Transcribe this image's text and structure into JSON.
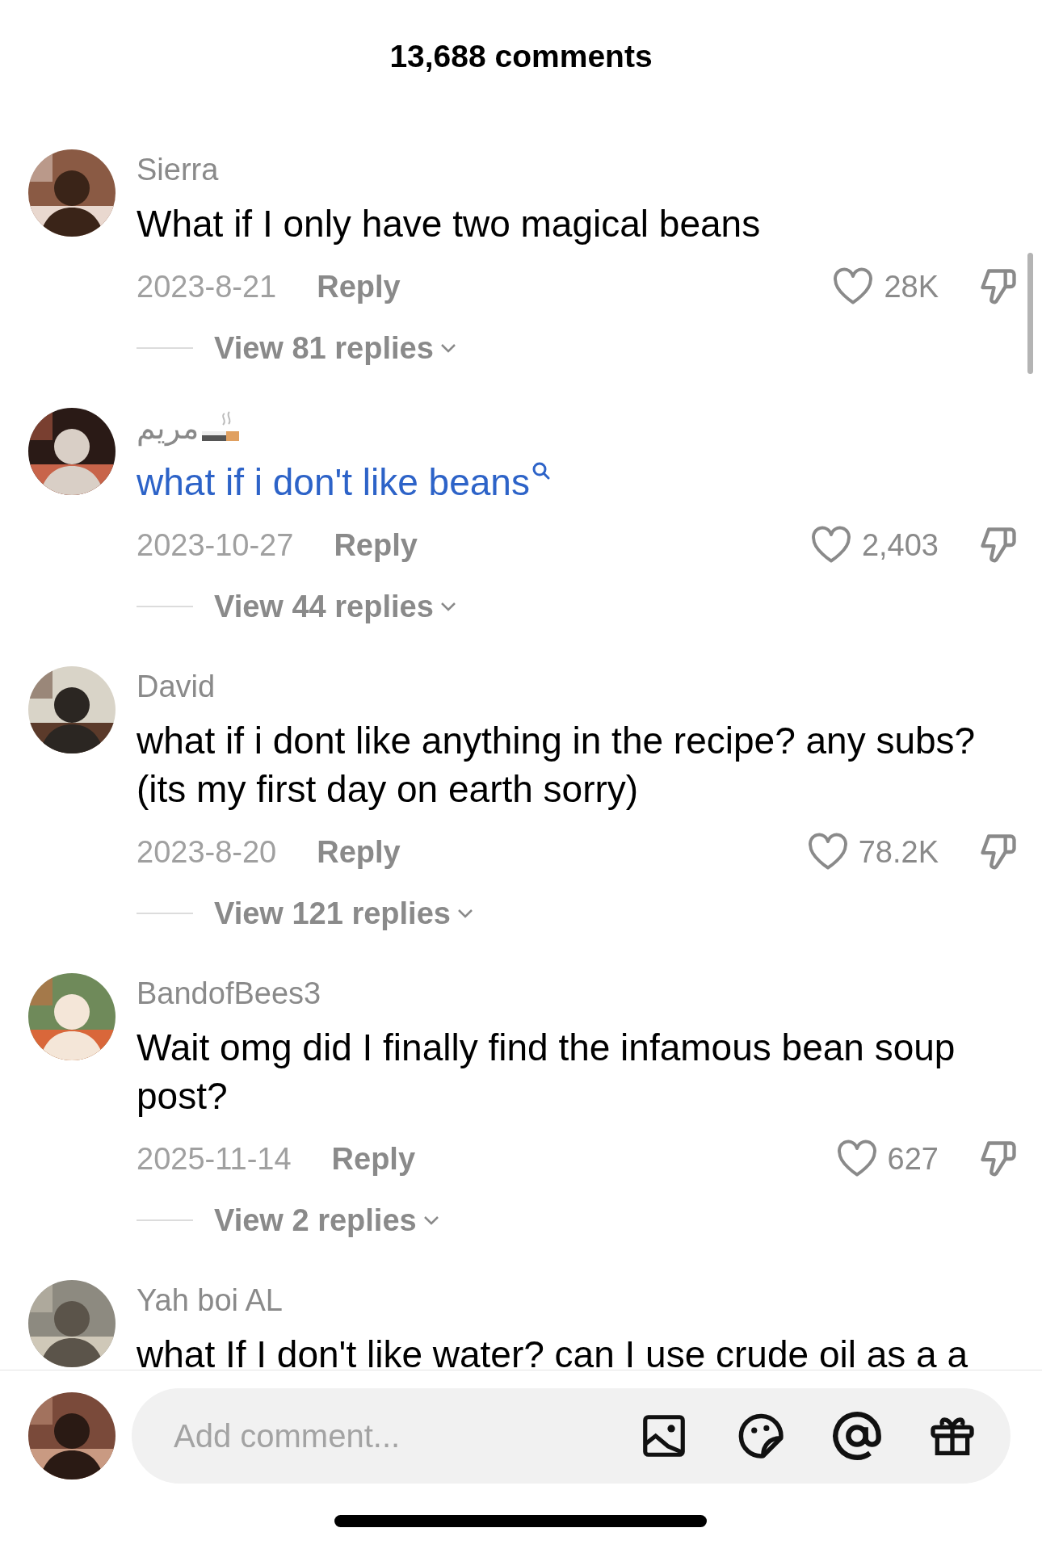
{
  "header": {
    "title": "13,688 comments"
  },
  "comments": [
    {
      "author": "Sierra",
      "text": "What if I only have two magical beans",
      "linked": false,
      "kind": "plain",
      "date": "2023-8-21",
      "reply": "Reply",
      "likes": "28K",
      "replies": "View 81 replies"
    },
    {
      "author": "مريم",
      "text": "what if i don't like beans",
      "linked": true,
      "kind": "with_emoji",
      "date": "2023-10-27",
      "reply": "Reply",
      "likes": "2,403",
      "replies": "View 44 replies"
    },
    {
      "author": "David",
      "text": "what if i dont like anything in the recipe? any subs? (its my first day on earth sorry)",
      "linked": false,
      "kind": "plain",
      "date": "2023-8-20",
      "reply": "Reply",
      "likes": "78.2K",
      "replies": "View 121 replies"
    },
    {
      "author": "BandofBees3",
      "text": "Wait omg did I finally find the infamous bean soup post?",
      "linked": false,
      "kind": "plain",
      "date": "2025-11-14",
      "reply": "Reply",
      "likes": "627",
      "replies": "View 2 replies"
    },
    {
      "author": "Yah boi AL",
      "text": "what If I don't like water? can I use crude oil as a a",
      "linked": false,
      "kind": "plain"
    }
  ],
  "composer": {
    "placeholder": "Add comment..."
  }
}
